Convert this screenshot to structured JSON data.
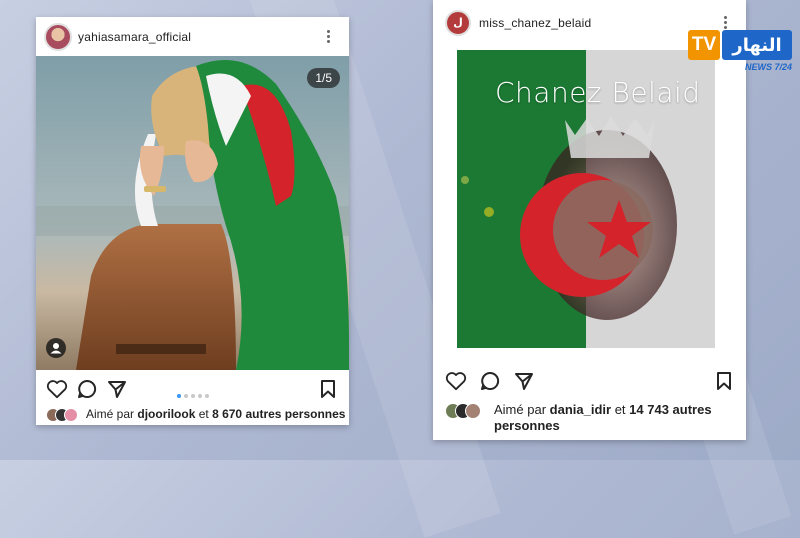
{
  "broadcaster": {
    "logo_letters": "TV",
    "logo_arabic": "النهار",
    "logo_tagline": "NEWS 7/24"
  },
  "post1": {
    "username": "yahiasamara_official",
    "carousel_counter": "1/5",
    "carousel_dots_total": 5,
    "carousel_active_index": 0,
    "likes": {
      "prefix": "Aimé par",
      "user": "djoorilook",
      "joiner": "et",
      "count": "8 670 autres personnes"
    }
  },
  "post2": {
    "username": "miss_chanez_belaid",
    "overlay_title": "Chanez Belaid",
    "likes": {
      "prefix": "Aimé par",
      "user": "dania_idir",
      "joiner": "et",
      "count_line1": "14 743 autres",
      "count_line2": "personnes"
    }
  },
  "icons": {
    "like": "heart-icon",
    "comment": "comment-icon",
    "share": "send-icon",
    "save": "bookmark-icon",
    "more": "more-vertical-icon",
    "tagged": "user-tag-icon"
  },
  "colors": {
    "flag_green": "#1f8a3b",
    "flag_red": "#d5232b",
    "flag_white": "#f4f4f4",
    "logo_orange": "#f29400",
    "logo_blue": "#1e66c8",
    "link_blue": "#3897f0"
  }
}
